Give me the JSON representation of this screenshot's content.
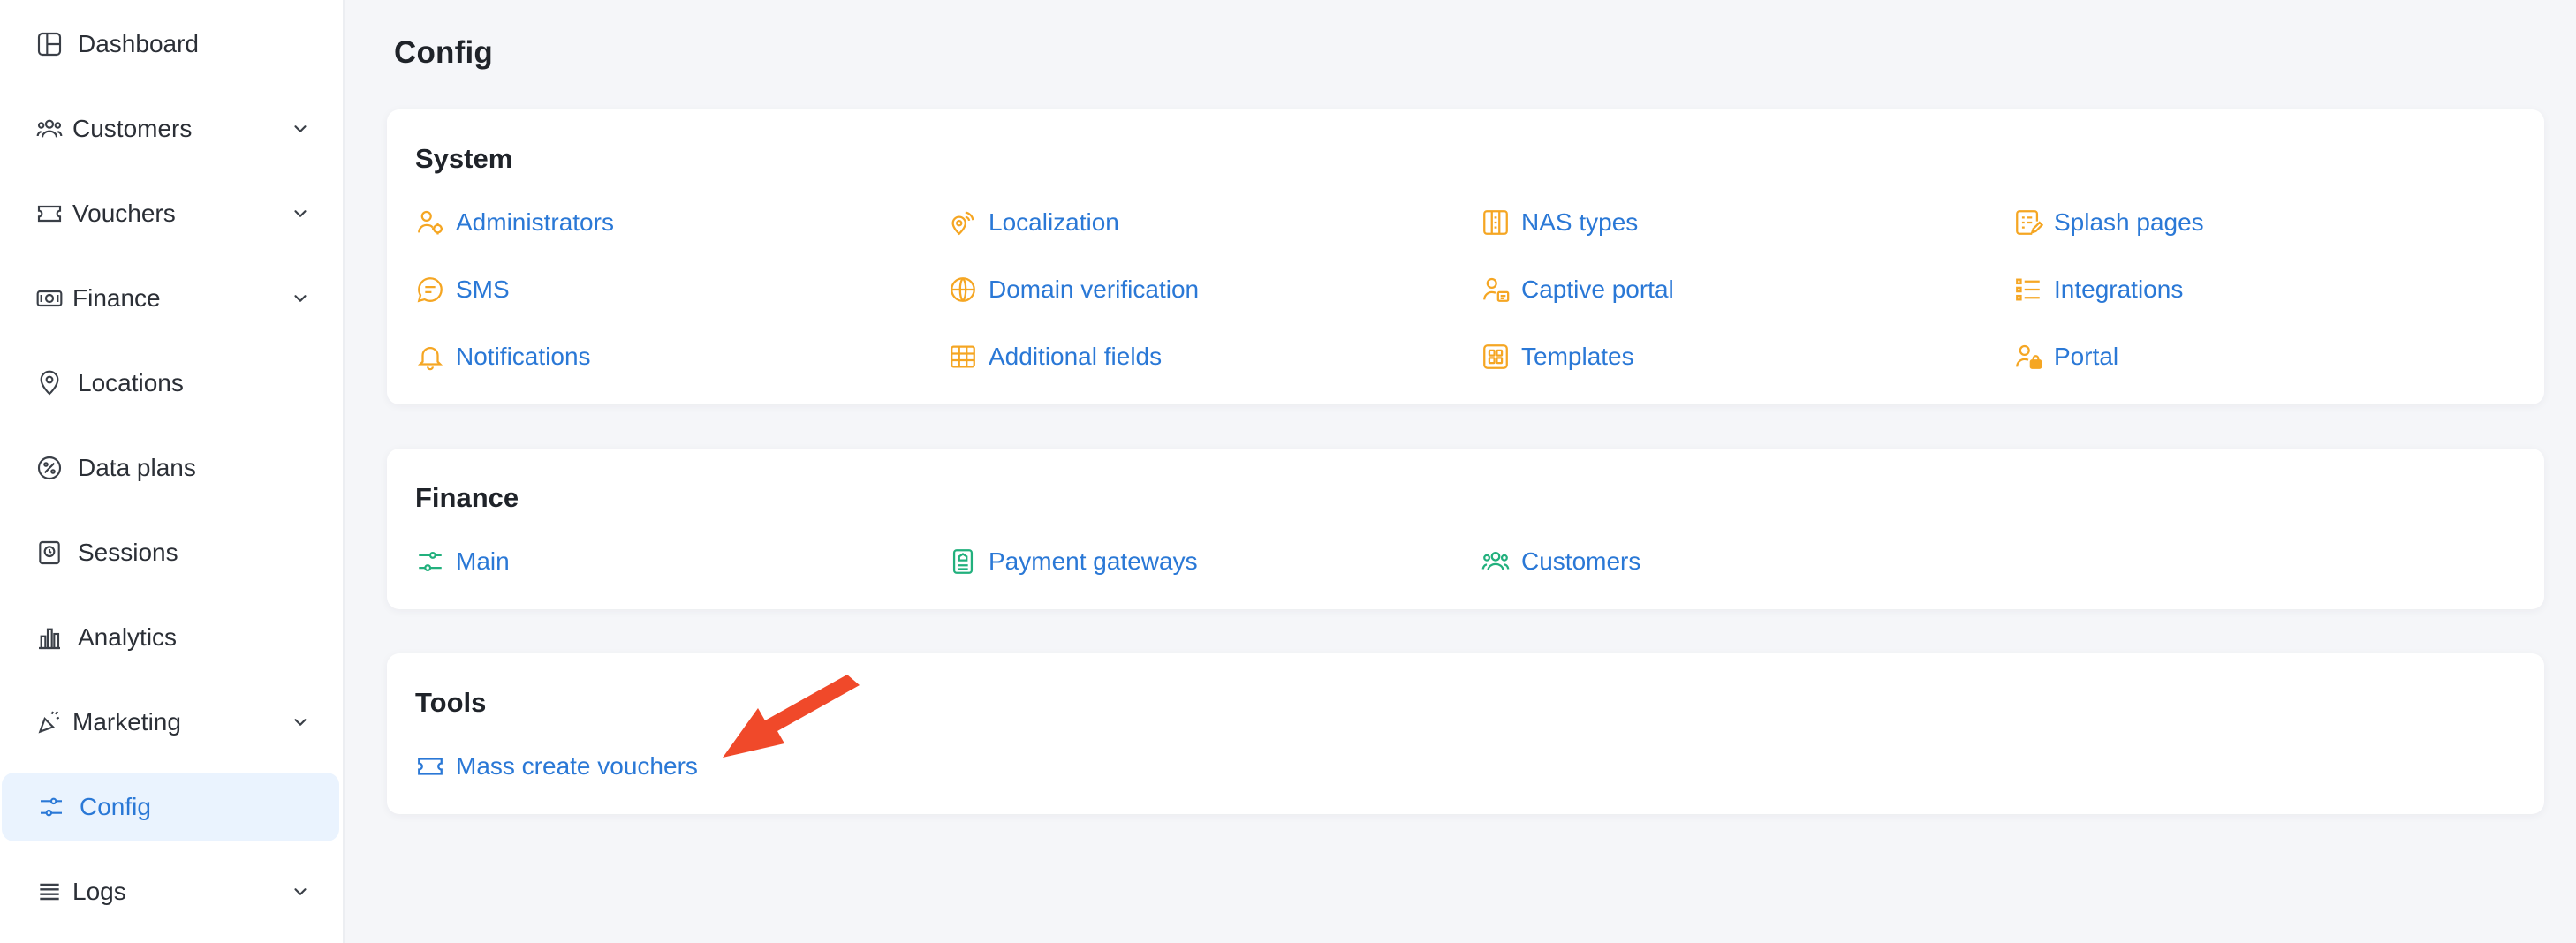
{
  "sidebar": {
    "items": [
      {
        "label": "Dashboard",
        "icon": "dashboard-icon",
        "chevron": false,
        "active": false
      },
      {
        "label": "Customers",
        "icon": "customers-icon",
        "chevron": true,
        "active": false
      },
      {
        "label": "Vouchers",
        "icon": "voucher-icon",
        "chevron": true,
        "active": false
      },
      {
        "label": "Finance",
        "icon": "finance-icon",
        "chevron": true,
        "active": false
      },
      {
        "label": "Locations",
        "icon": "location-pin-icon",
        "chevron": false,
        "active": false
      },
      {
        "label": "Data plans",
        "icon": "data-plans-icon",
        "chevron": false,
        "active": false
      },
      {
        "label": "Sessions",
        "icon": "sessions-icon",
        "chevron": false,
        "active": false
      },
      {
        "label": "Analytics",
        "icon": "analytics-icon",
        "chevron": false,
        "active": false
      },
      {
        "label": "Marketing",
        "icon": "marketing-icon",
        "chevron": true,
        "active": false
      },
      {
        "label": "Config",
        "icon": "config-icon",
        "chevron": false,
        "active": true
      },
      {
        "label": "Logs",
        "icon": "logs-icon",
        "chevron": true,
        "active": false
      }
    ]
  },
  "page": {
    "title": "Config"
  },
  "sections": {
    "system": {
      "title": "System",
      "links": [
        {
          "label": "Administrators",
          "icon": "administrators-icon"
        },
        {
          "label": "Localization",
          "icon": "localization-icon"
        },
        {
          "label": "NAS types",
          "icon": "nas-types-icon"
        },
        {
          "label": "Splash pages",
          "icon": "splash-pages-icon"
        },
        {
          "label": "SMS",
          "icon": "sms-icon"
        },
        {
          "label": "Domain verification",
          "icon": "globe-icon"
        },
        {
          "label": "Captive portal",
          "icon": "captive-portal-icon"
        },
        {
          "label": "Integrations",
          "icon": "integrations-icon"
        },
        {
          "label": "Notifications",
          "icon": "bell-icon"
        },
        {
          "label": "Additional fields",
          "icon": "table-grid-icon"
        },
        {
          "label": "Templates",
          "icon": "templates-icon"
        },
        {
          "label": "Portal",
          "icon": "portal-icon"
        }
      ]
    },
    "finance": {
      "title": "Finance",
      "links": [
        {
          "label": "Main",
          "icon": "sliders-icon"
        },
        {
          "label": "Payment gateways",
          "icon": "payment-gateways-icon"
        },
        {
          "label": "Customers",
          "icon": "customers-group-icon"
        }
      ]
    },
    "tools": {
      "title": "Tools",
      "links": [
        {
          "label": "Mass create vouchers",
          "icon": "voucher-ticket-icon"
        }
      ]
    }
  },
  "colors": {
    "link": "#2a78d6",
    "system_icon": "#f5a623",
    "finance_icon": "#22b07d",
    "tools_icon": "#2a78d6",
    "arrow": "#f0492a"
  }
}
